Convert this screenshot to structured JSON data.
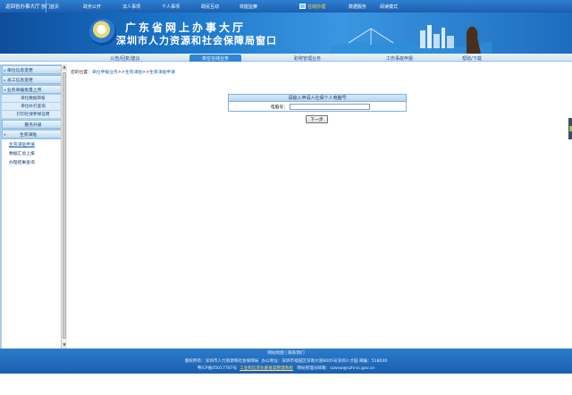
{
  "topnav": {
    "home": "返回省办事大厅",
    "items": [
      "部门首页",
      "政务公开",
      "法人事项",
      "个人事项",
      "政民互动",
      "效能监察",
      "在线办理",
      "数据服务",
      "阅读模式"
    ]
  },
  "banner": {
    "title1": "广东省网上办事大厅",
    "title2": "深圳市人力资源和社会保障局窗口"
  },
  "tabs": [
    "公告/回复/建议",
    "单位在线业务",
    "职称管理业务",
    "工伤事故申报",
    "帮助/下载"
  ],
  "sidebar": {
    "items": [
      "单位信息变更",
      "员工信息变更"
    ],
    "group": "业务单据批量上传",
    "subs": [
      "单位数据审核",
      "单位补打查询",
      "打印社保参保证明"
    ],
    "group2": [
      "服务升级",
      "生育津贴"
    ],
    "links": [
      "生育津贴申请",
      "数据汇总上报",
      "办理结果查询"
    ]
  },
  "breadcrumb": {
    "prefix": "您的位置：",
    "c1": "单位申报业务",
    "sep1": ">>",
    "c2": "生育津贴",
    "sep2": ">>",
    "c3": "生育津贴申请"
  },
  "form": {
    "header": "请输入申请人社保个人电脑号",
    "label": "电脑号：",
    "value": "",
    "button": "下一步"
  },
  "footer": {
    "l1": "网站地图 | 联系我们",
    "l2a": "版权所有：深圳市人力资源和社会保障局",
    "l2b": "办公地址：深圳市福田区深南大道8005号深圳人才园 邮编：518040",
    "l3a": "粤ICP备05017787号",
    "l3b": "工业和信息化部备案管理系统",
    "l3c": "网站管理员邮箱：szwsw@szhrss.gov.cn"
  },
  "colors": {
    "nav": "#1c5fae",
    "sidebar": "#a8cdea",
    "active_tab": "#2f86d6"
  }
}
